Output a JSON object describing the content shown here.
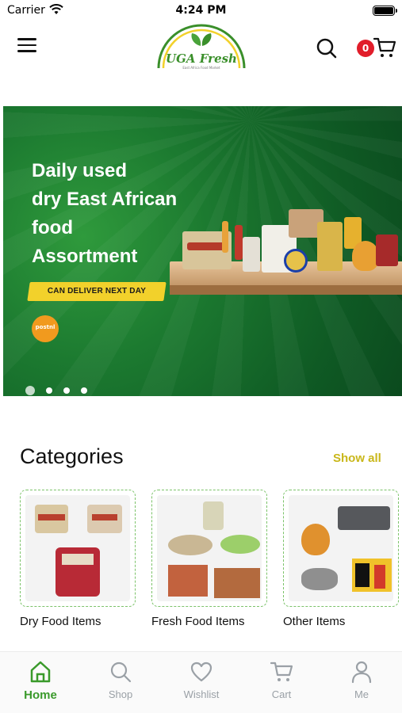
{
  "status_bar": {
    "carrier": "Carrier",
    "time": "4:24 PM"
  },
  "header": {
    "logo_text": "UGA Fresh",
    "logo_tagline": "East Africa Food Market",
    "cart_count": "0",
    "icons": [
      "menu-icon",
      "search-icon",
      "cart-icon"
    ]
  },
  "banner": {
    "headline": [
      "Daily used",
      "dry East African",
      "food",
      "Assortment"
    ],
    "tag": "CAN DELIVER NEXT DAY",
    "partner_logo": "postnl",
    "slide_count": 4,
    "active_slide": 1,
    "colors": {
      "background": "#1c7a30",
      "tag": "#f2d12b"
    }
  },
  "categories": {
    "title": "Categories",
    "show_all": "Show all",
    "items": [
      {
        "label": "Dry Food Items"
      },
      {
        "label": "Fresh Food Items"
      },
      {
        "label": "Other Items"
      }
    ]
  },
  "bottom_nav": {
    "items": [
      {
        "label": "Home",
        "icon": "home-icon",
        "active": true
      },
      {
        "label": "Shop",
        "icon": "search-icon",
        "active": false
      },
      {
        "label": "Wishlist",
        "icon": "heart-icon",
        "active": false
      },
      {
        "label": "Cart",
        "icon": "cart-icon",
        "active": false
      },
      {
        "label": "Me",
        "icon": "user-icon",
        "active": false
      }
    ],
    "colors": {
      "active": "#3a9a2b",
      "inactive": "#9aa0a6"
    }
  }
}
